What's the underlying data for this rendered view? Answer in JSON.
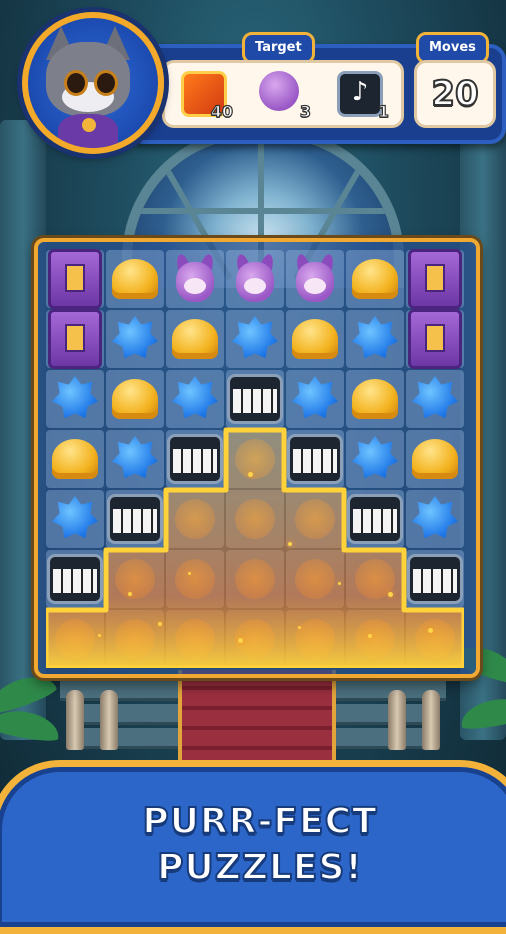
{
  "hud": {
    "target_label": "Target",
    "moves_label": "Moves",
    "moves_value": "20",
    "goals": [
      {
        "icon": "fire-tile-icon",
        "count": "40"
      },
      {
        "icon": "purple-bunny-icon",
        "count": "3"
      },
      {
        "icon": "music-note-icon",
        "count": "1"
      }
    ]
  },
  "board": {
    "rows": [
      [
        "door",
        "bell",
        "bunny",
        "bunny",
        "bunny",
        "bell",
        "door"
      ],
      [
        "door",
        "star",
        "bell",
        "star",
        "bell",
        "star",
        "door"
      ],
      [
        "star",
        "bell",
        "star",
        "piano",
        "star",
        "bell",
        "star"
      ],
      [
        "bell",
        "star",
        "piano",
        "fire",
        "piano",
        "star",
        "bell"
      ],
      [
        "star",
        "piano",
        "fire",
        "fire",
        "fire",
        "piano",
        "star"
      ],
      [
        "piano",
        "fire",
        "fire",
        "fire",
        "fire",
        "fire",
        "piano"
      ],
      [
        "fire",
        "fire",
        "fire",
        "fire",
        "fire",
        "fire",
        "fire"
      ]
    ]
  },
  "banner": {
    "line1": "PURR-FECT",
    "line2": "PUZZLES!"
  },
  "colors": {
    "accent": "#f3b23a",
    "panel": "#1a3f8f",
    "fire": "#ff9a1f"
  }
}
